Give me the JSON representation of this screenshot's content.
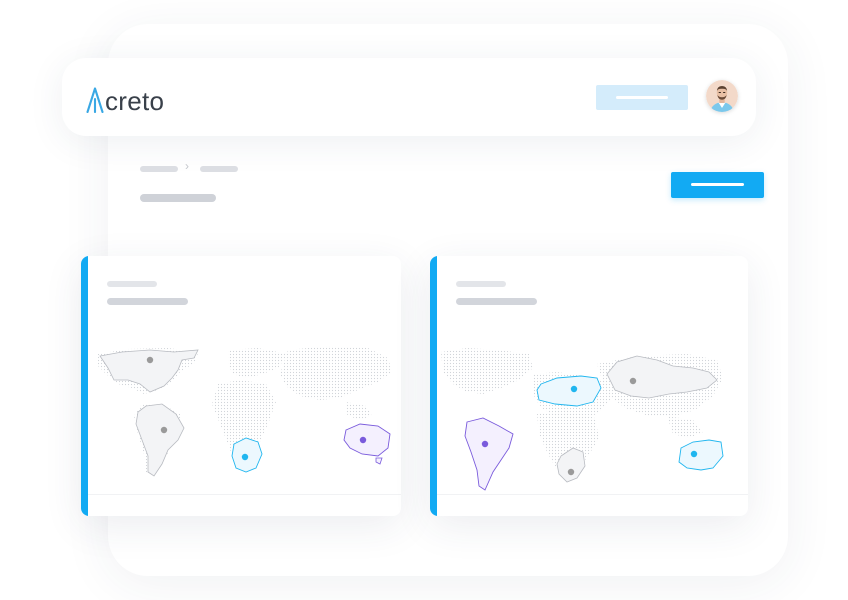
{
  "app": {
    "logo_text": "creto",
    "logo_mark": "A",
    "logo_color": "#3aa8e4"
  },
  "colors": {
    "primary": "#12aaf3",
    "primary_light": "#d4ecfb",
    "purple": "#7a5bdc",
    "cyan": "#20b6ef",
    "gray_dot": "#9a9a9a"
  },
  "icons": {
    "breadcrumb_separator": "›"
  },
  "cards": [
    {
      "regions": [
        {
          "name": "north-america",
          "state": "selected-gray"
        },
        {
          "name": "south-america",
          "state": "selected-gray"
        },
        {
          "name": "africa-south",
          "state": "highlight-cyan"
        },
        {
          "name": "australia",
          "state": "highlight-purple"
        }
      ]
    },
    {
      "regions": [
        {
          "name": "europe",
          "state": "highlight-cyan"
        },
        {
          "name": "asia",
          "state": "selected-gray"
        },
        {
          "name": "south-america",
          "state": "highlight-purple"
        },
        {
          "name": "africa-south",
          "state": "selected-gray"
        },
        {
          "name": "australia",
          "state": "highlight-cyan"
        }
      ]
    }
  ]
}
